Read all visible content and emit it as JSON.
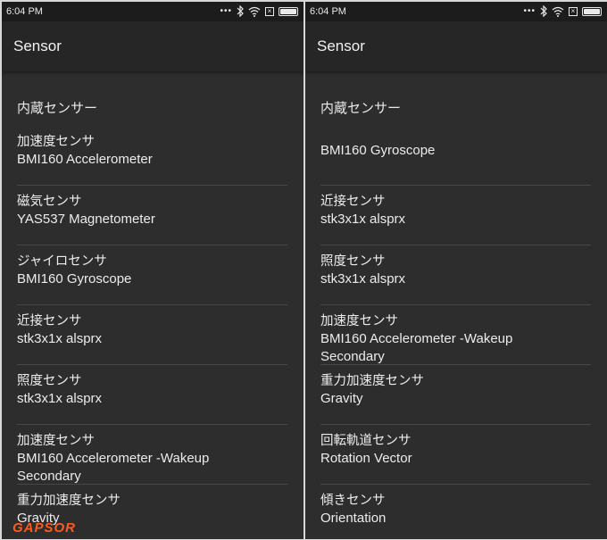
{
  "screens": [
    {
      "status": {
        "time": "6:04 PM",
        "dots": "•••"
      },
      "appbar": {
        "title": "Sensor"
      },
      "section": "内蔵センサー",
      "items": [
        {
          "type": "加速度センサ",
          "name": "BMI160 Accelerometer"
        },
        {
          "type": "磁気センサ",
          "name": "YAS537 Magnetometer"
        },
        {
          "type": "ジャイロセンサ",
          "name": "BMI160 Gyroscope"
        },
        {
          "type": "近接センサ",
          "name": "stk3x1x alsprx"
        },
        {
          "type": "照度センサ",
          "name": "stk3x1x alsprx"
        },
        {
          "type": "加速度センサ",
          "name": "BMI160 Accelerometer -Wakeup",
          "name2": "Secondary"
        },
        {
          "type": "重力加速度センサ",
          "name": "Gravity"
        }
      ]
    },
    {
      "status": {
        "time": "6:04 PM",
        "dots": "•••"
      },
      "appbar": {
        "title": "Sensor"
      },
      "section": "内蔵センサー",
      "items": [
        {
          "type": "",
          "name": "BMI160 Gyroscope"
        },
        {
          "type": "近接センサ",
          "name": "stk3x1x alsprx"
        },
        {
          "type": "照度センサ",
          "name": "stk3x1x alsprx"
        },
        {
          "type": "加速度センサ",
          "name": "BMI160 Accelerometer -Wakeup",
          "name2": "Secondary"
        },
        {
          "type": "重力加速度センサ",
          "name": "Gravity"
        },
        {
          "type": "回転軌道センサ",
          "name": "Rotation Vector"
        },
        {
          "type": "傾きセンサ",
          "name": "Orientation"
        }
      ]
    }
  ],
  "watermark": "GAPSOR",
  "colors": {
    "background": "#2d2d2d",
    "appbar": "#262626",
    "divider": "#474747",
    "text": "#ececec",
    "watermark": "#ff5a1a"
  }
}
